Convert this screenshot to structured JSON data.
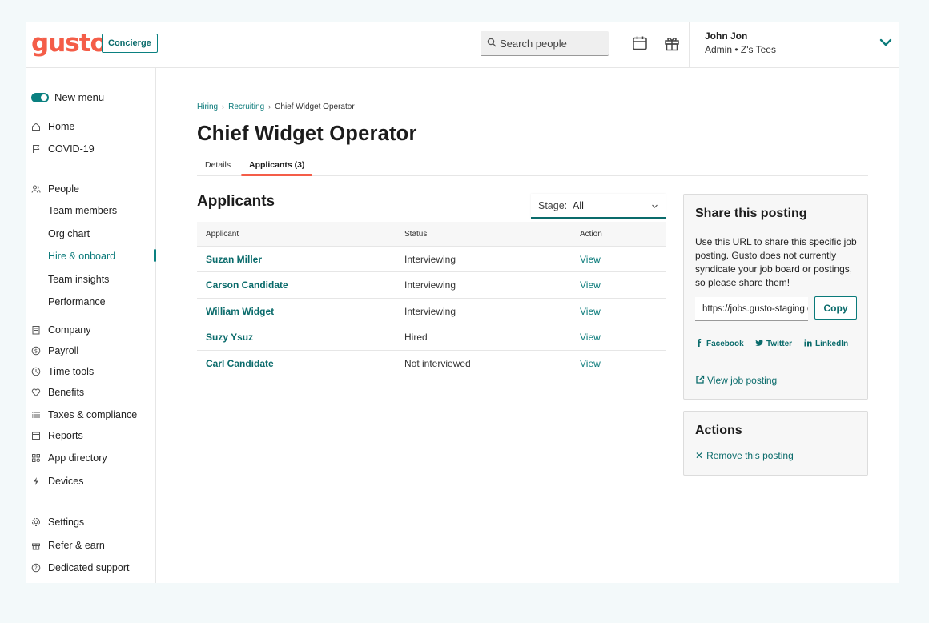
{
  "header": {
    "logo": "gusto",
    "concierge_label": "Concierge",
    "search_placeholder": "Search people",
    "user_name": "John Jon",
    "user_role": "Admin • Z's Tees"
  },
  "sidebar": {
    "toggle_label": "New menu",
    "items": [
      {
        "label": "Home",
        "icon": "home-icon"
      },
      {
        "label": "COVID-19",
        "icon": "flag-icon"
      },
      {
        "label": "People",
        "icon": "people-icon"
      },
      {
        "label": "Team members"
      },
      {
        "label": "Org chart"
      },
      {
        "label": "Hire & onboard",
        "active": true
      },
      {
        "label": "Team insights"
      },
      {
        "label": "Performance"
      },
      {
        "label": "Company",
        "icon": "building-icon"
      },
      {
        "label": "Payroll",
        "icon": "dollar-icon"
      },
      {
        "label": "Time tools",
        "icon": "clock-icon"
      },
      {
        "label": "Benefits",
        "icon": "heart-icon"
      },
      {
        "label": "Taxes & compliance",
        "icon": "list-icon"
      },
      {
        "label": "Reports",
        "icon": "reports-icon"
      },
      {
        "label": "App directory",
        "icon": "grid-icon"
      },
      {
        "label": "Devices",
        "icon": "bolt-icon"
      },
      {
        "label": "Settings",
        "icon": "gear-icon"
      },
      {
        "label": "Refer & earn",
        "icon": "gift-icon"
      },
      {
        "label": "Dedicated support",
        "icon": "support-icon"
      }
    ]
  },
  "breadcrumb": [
    "Hiring",
    "Recruiting",
    "Chief Widget Operator"
  ],
  "page_title": "Chief Widget Operator",
  "tabs": [
    "Details",
    "Applicants (3)"
  ],
  "applicants": {
    "title": "Applicants",
    "stage_label": "Stage:",
    "stage_value": "All",
    "columns": [
      "Applicant",
      "Status",
      "Action"
    ],
    "rows": [
      {
        "name": "Suzan Miller",
        "status": "Interviewing",
        "action": "View"
      },
      {
        "name": "Carson Candidate",
        "status": "Interviewing",
        "action": "View"
      },
      {
        "name": "William Widget",
        "status": "Interviewing",
        "action": "View"
      },
      {
        "name": "Suzy Ysuz",
        "status": "Hired",
        "action": "View"
      },
      {
        "name": "Carl Candidate",
        "status": "Not interviewed",
        "action": "View"
      }
    ]
  },
  "share": {
    "title": "Share this posting",
    "description": "Use this URL to share this specific job posting. Gusto does not currently syndicate your job board or postings, so please share them!",
    "url": "https://jobs.gusto-staging.com/postings/chief-widget-operator",
    "copy_label": "Copy",
    "facebook": "Facebook",
    "twitter": "Twitter",
    "linkedin": "LinkedIn",
    "view_posting": "View job posting"
  },
  "actions": {
    "title": "Actions",
    "remove": "Remove this posting"
  },
  "colors": {
    "brand": "#f45d48",
    "accent": "#0a7a7a",
    "background": "#f3f9fa"
  }
}
